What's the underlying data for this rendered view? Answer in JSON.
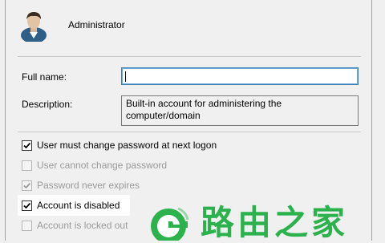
{
  "user": {
    "name": "Administrator",
    "icon": "user-avatar-icon"
  },
  "fields": {
    "fullname_label": "Full name:",
    "fullname_value": "",
    "description_label": "Description:",
    "description_value": "Built-in account for administering the computer/domain"
  },
  "options": [
    {
      "label": "User must change password at next logon",
      "checked": true,
      "disabled": false
    },
    {
      "label": "User cannot change password",
      "checked": false,
      "disabled": true
    },
    {
      "label": "Password never expires",
      "checked": true,
      "disabled": true
    },
    {
      "label": "Account is disabled",
      "checked": true,
      "disabled": false
    },
    {
      "label": "Account is locked out",
      "checked": false,
      "disabled": true
    }
  ],
  "watermark": {
    "text": "路由之家",
    "color": "#2bb24c"
  }
}
